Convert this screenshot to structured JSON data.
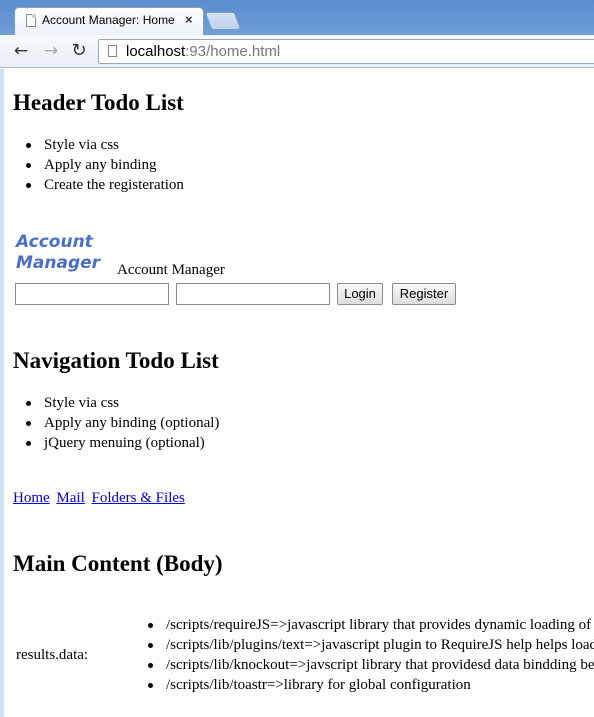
{
  "browser": {
    "tab_title": "Account Manager: Home",
    "tab_close": "×",
    "url_host": "localhost",
    "url_port": ":93",
    "url_path": "/home.html",
    "icons": [
      "back-arrow-icon",
      "forward-arrow-icon",
      "reload-icon",
      "page-icon",
      "close-icon"
    ]
  },
  "header": {
    "title": "Header Todo List",
    "todos": [
      "Style via css",
      "Apply any binding",
      "Create the registeration"
    ]
  },
  "account": {
    "logo_line1": "Account",
    "logo_line2": "Manager",
    "caption": "Account Manager",
    "username_value": "",
    "password_value": "",
    "login_label": "Login",
    "register_label": "Register"
  },
  "navigation": {
    "title": "Navigation Todo List",
    "todos": [
      "Style via css",
      "Apply any binding (optional)",
      "jQuery menuing (optional)"
    ],
    "links": [
      "Home",
      "Mail",
      "Folders & Files"
    ]
  },
  "main": {
    "title": "Main Content (Body)",
    "results_label": "results.data:",
    "results": [
      "/scripts/requireJS=>javascript library that provides dynamic loading of s",
      "/scripts/lib/plugins/text=>javascript plugin to RequireJS help helps load t",
      "/scripts/lib/knockout=>javscript library that providesd data bindding bet",
      "/scripts/lib/toastr=>library for global configuration"
    ]
  }
}
